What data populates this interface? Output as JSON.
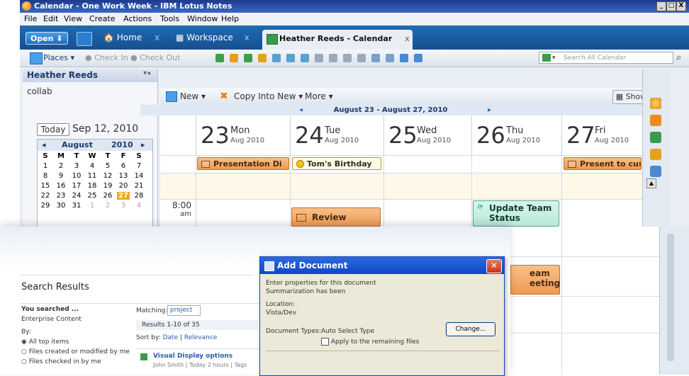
{
  "window": {
    "title": "Calendar - One Work Week - IBM Lotus Notes",
    "controls": [
      "_",
      "□",
      "X"
    ]
  },
  "menu": [
    "File",
    "Edit",
    "View",
    "Create",
    "Actions",
    "Tools",
    "Window",
    "Help"
  ],
  "tabs": {
    "open_label": "Open",
    "home": "Home",
    "workspace": "Workspace",
    "active": "Heather Reeds - Calendar",
    "close": "x"
  },
  "toolbar": {
    "places": "Places",
    "check_in": "Check In",
    "check_out": "Check Out",
    "search_placeholder": "Search All Calendar"
  },
  "left_panel": {
    "owner": "Heather Reeds",
    "subtitle": "collab",
    "today_label": "Today",
    "today_date": "Sep 12, 2010",
    "mini_cal": {
      "month": "August",
      "year": "2010",
      "weekdays": [
        "S",
        "M",
        "T",
        "W",
        "T",
        "F",
        "S"
      ],
      "rows": [
        [
          "1",
          "2",
          "3",
          "4",
          "5",
          "6",
          "7"
        ],
        [
          "8",
          "9",
          "10",
          "11",
          "12",
          "13",
          "14"
        ],
        [
          "15",
          "16",
          "17",
          "18",
          "19",
          "20",
          "21"
        ],
        [
          "22",
          "23",
          "24",
          "25",
          "26",
          "27",
          "28"
        ],
        [
          "29",
          "30",
          "31",
          "1",
          "2",
          "3",
          "4"
        ]
      ],
      "selected": "27"
    }
  },
  "cal_toolbar": {
    "new": "New",
    "copy_into_new": "Copy Into New",
    "more": "More",
    "show": "Show"
  },
  "week_range": "August 23 - August 27, 2010",
  "days": [
    {
      "num": "23",
      "name": "Mon",
      "sub": "Aug 2010"
    },
    {
      "num": "24",
      "name": "Tue",
      "sub": "Aug 2010"
    },
    {
      "num": "25",
      "name": "Wed",
      "sub": "Aug 2010"
    },
    {
      "num": "26",
      "name": "Thu",
      "sub": "Aug 2010"
    },
    {
      "num": "27",
      "name": "Fri",
      "sub": "Aug 2010"
    }
  ],
  "allday_events": {
    "presentation": "Presentation Di",
    "birthday": "Tom's Birthday",
    "present_cust": "Present to cust"
  },
  "time_label": {
    "hour": "8:00",
    "ampm": "am"
  },
  "timed_events": {
    "review": "Review",
    "update_team": "Update Team",
    "status": "Status",
    "team_meeting_1": "eam",
    "team_meeting_2": "eeting"
  },
  "search_window": {
    "title": "Search Results",
    "you_searched": "You searched ...",
    "enterprise": "Enterprise Content",
    "by": "By:",
    "options": [
      "All top items",
      "Files created or modified by me",
      "Files checked in by me"
    ],
    "matching_label": "Matching:",
    "matching_value": "project",
    "results_count": "Results 1-10 of 35",
    "sort_by": "Sort by:",
    "sort_date": "Date",
    "sort_relevance": "Relevance",
    "result_title": "Visual Display options",
    "result_meta": "John Smith | Today 2 hours | Tags"
  },
  "add_document": {
    "title": "Add Document",
    "line1": "Enter properties for this document",
    "line2": "Summarization has been",
    "field_label": "Location:",
    "field_value": "Vista/Dev",
    "doc_types": "Document Types:",
    "doc_type_value": "Auto Select Type",
    "change": "Change...",
    "apply_remaining": "Apply to the remaining files"
  }
}
